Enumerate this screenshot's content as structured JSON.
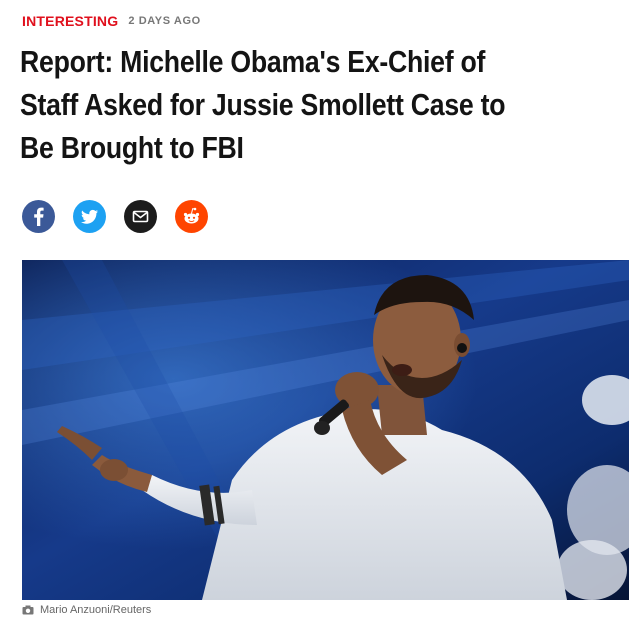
{
  "article": {
    "category": "INTERESTING",
    "time_ago": "2 DAYS AGO",
    "headline": "Report: Michelle Obama's Ex-Chief of Staff Asked for Jussie Smollett Case to Be Brought to FBI"
  },
  "share": {
    "facebook_color": "#3b5998",
    "twitter_color": "#1da1f2",
    "email_color": "#1c1c1c",
    "reddit_color": "#ff4500"
  },
  "hero": {
    "credit": "Mario Anzuoni/Reuters"
  },
  "colors": {
    "accent": "#e0101d",
    "headline": "#141414"
  }
}
